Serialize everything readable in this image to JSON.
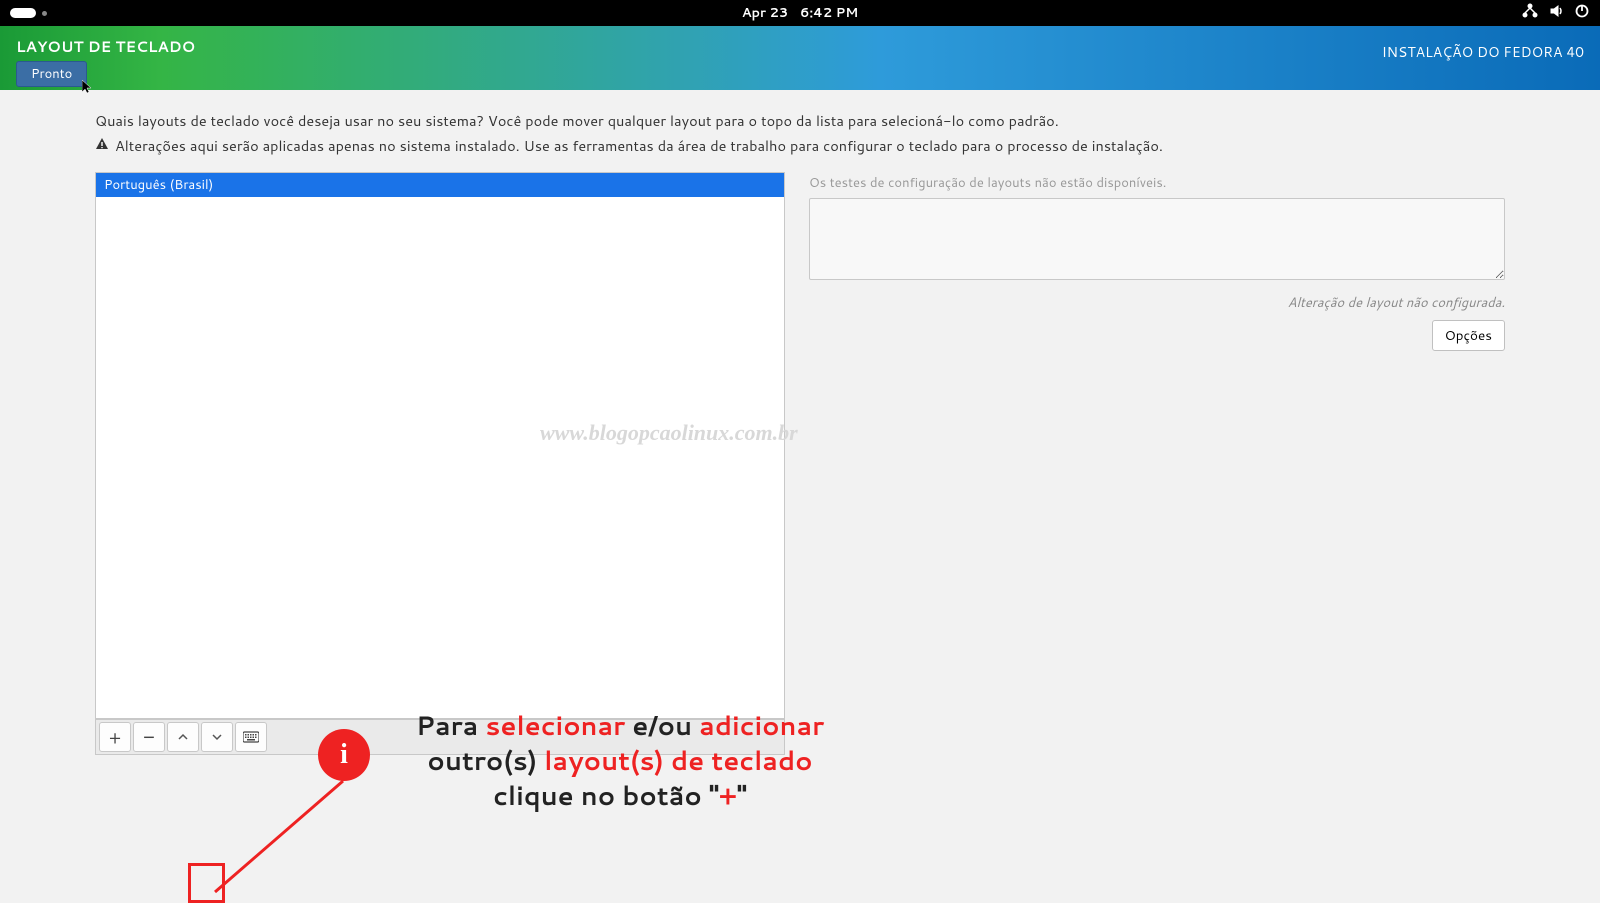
{
  "topbar": {
    "date": "Apr 23",
    "time": "6:42 PM"
  },
  "header": {
    "title": "LAYOUT DE TECLADO",
    "done_label": "Pronto",
    "installer_label": "INSTALAÇÃO DO FEDORA 40"
  },
  "instructions": {
    "line1": "Quais layouts de teclado você deseja usar no seu sistema?  Você pode mover qualquer layout para o topo da lista para selecioná-lo como padrão.",
    "line2": "Alterações aqui serão aplicadas apenas no sistema instalado. Use as ferramentas da área de trabalho para configurar o teclado para o processo de instalação."
  },
  "layouts": {
    "items": [
      "Português (Brasil)"
    ]
  },
  "toolbar_buttons": {
    "add": "+",
    "remove": "−",
    "up": "˄",
    "down": "˅"
  },
  "right": {
    "test_label": "Os testes de configuração de layouts não estão disponíveis.",
    "switch_status": "Alteração de layout não configurada.",
    "options_label": "Opções"
  },
  "watermark": "www.blogopcaolinux.com.br",
  "annotation": {
    "text_pre": "Para ",
    "text_sel": "selecionar",
    "text_mid": " e/ou ",
    "text_add": "adicionar",
    "text_line2_pre": "outro(s) ",
    "text_layout": "layout(s) de teclado",
    "text_line3_pre": "clique no botão \"",
    "text_plus": "+",
    "text_line3_post": "\"",
    "info_letter": "i"
  }
}
